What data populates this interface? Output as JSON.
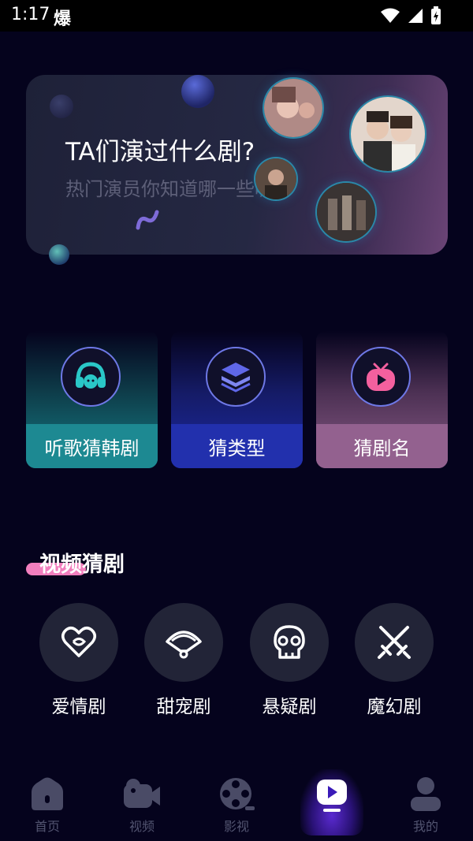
{
  "status_bar": {
    "time": "1:17",
    "app_icon": "爆"
  },
  "banner": {
    "title": "TA们演过什么剧?",
    "subtitle": "热门演员你知道哪一些呢"
  },
  "categories": [
    {
      "label": "听歌猜韩剧",
      "icon": "headphones-icon",
      "color": "#1d8992"
    },
    {
      "label": "猜类型",
      "icon": "layers-icon",
      "color": "#2230ad"
    },
    {
      "label": "猜剧名",
      "icon": "tv-play-icon",
      "color": "#93618f"
    }
  ],
  "section": {
    "title": "视频猜剧",
    "accent": "#f27fbe"
  },
  "genres": [
    {
      "label": "爱情剧",
      "icon": "heart-icon"
    },
    {
      "label": "甜宠剧",
      "icon": "fan-icon"
    },
    {
      "label": "悬疑剧",
      "icon": "skull-icon"
    },
    {
      "label": "魔幻剧",
      "icon": "crossed-swords-icon"
    }
  ],
  "nav": {
    "items": [
      {
        "label": "首页",
        "icon": "home-icon"
      },
      {
        "label": "视频",
        "icon": "video-camera-icon"
      },
      {
        "label": "影视",
        "icon": "film-reel-icon"
      },
      {
        "label": "",
        "icon": "play-icon",
        "active": true
      },
      {
        "label": "我的",
        "icon": "user-icon"
      }
    ],
    "active_color": "#5a2ad0"
  }
}
